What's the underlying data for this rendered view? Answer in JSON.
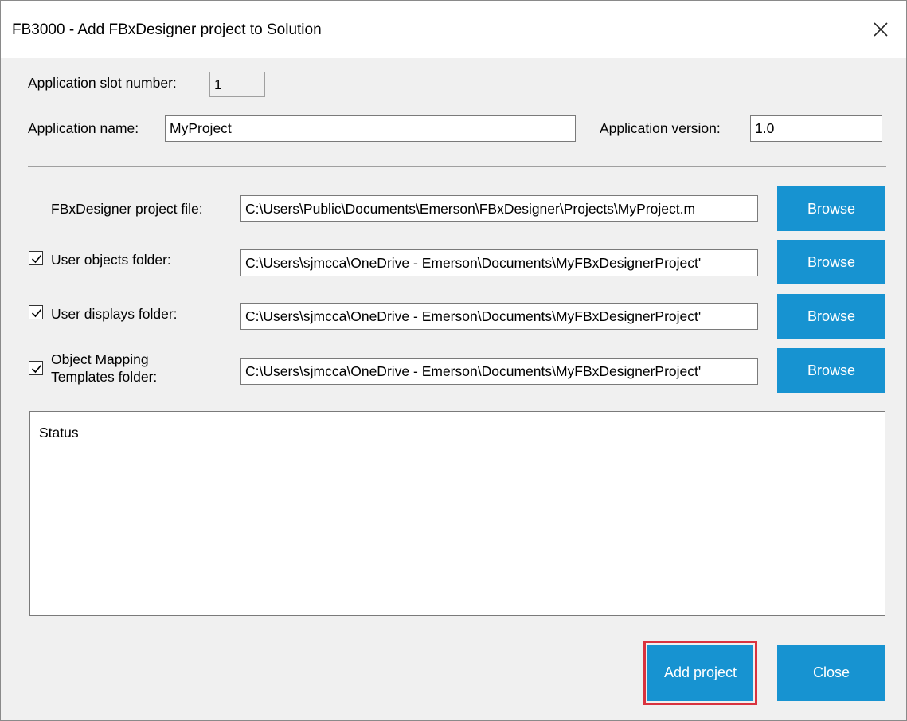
{
  "window": {
    "title": "FB3000 - Add FBxDesigner project to Solution",
    "close_glyph": "✕"
  },
  "app": {
    "slot_label": "Application slot number:",
    "slot_value": "1",
    "name_label": "Application name:",
    "name_value": "MyProject",
    "version_label": "Application version:",
    "version_value": "1.0"
  },
  "paths": {
    "project_file_label": "FBxDesigner project file:",
    "project_file_value": "C:\\Users\\Public\\Documents\\Emerson\\FBxDesigner\\Projects\\MyProject.m",
    "user_objects_label": "User objects folder:",
    "user_objects_checked": true,
    "user_objects_value": "C:\\Users\\sjmcca\\OneDrive - Emerson\\Documents\\MyFBxDesignerProject'",
    "user_displays_label": "User displays folder:",
    "user_displays_checked": true,
    "user_displays_value": "C:\\Users\\sjmcca\\OneDrive - Emerson\\Documents\\MyFBxDesignerProject'",
    "mapping_label_line1": "Object Mapping",
    "mapping_label_line2": "Templates folder:",
    "mapping_checked": true,
    "mapping_value": "C:\\Users\\sjmcca\\OneDrive - Emerson\\Documents\\MyFBxDesignerProject'",
    "browse_label": "Browse"
  },
  "status": {
    "label": "Status"
  },
  "footer": {
    "add_label": "Add project",
    "close_label": "Close"
  },
  "colors": {
    "accent": "#1793d1",
    "highlight": "#d9333f"
  }
}
